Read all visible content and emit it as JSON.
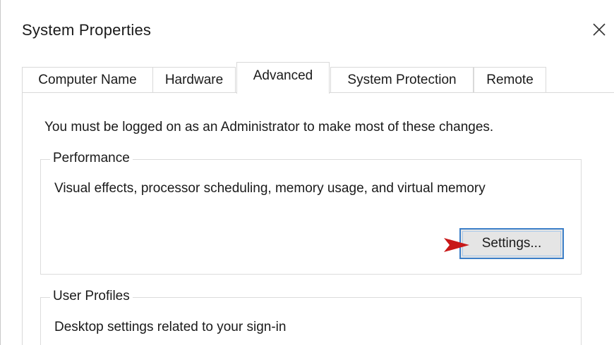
{
  "window": {
    "title": "System Properties",
    "close_icon": "close-icon"
  },
  "tabs": [
    {
      "label": "Computer Name",
      "active": false
    },
    {
      "label": "Hardware",
      "active": false
    },
    {
      "label": "Advanced",
      "active": true
    },
    {
      "label": "System Protection",
      "active": false
    },
    {
      "label": "Remote",
      "active": false
    }
  ],
  "advanced": {
    "admin_note": "You must be logged on as an Administrator to make most of these changes.",
    "performance": {
      "title": "Performance",
      "description": "Visual effects, processor scheduling, memory usage, and virtual memory",
      "settings_label": "Settings..."
    },
    "user_profiles": {
      "title": "User Profiles",
      "description": "Desktop settings related to your sign-in"
    }
  },
  "colors": {
    "focus_border": "#3c7fc8",
    "annotation_arrow": "#d01e1e"
  }
}
